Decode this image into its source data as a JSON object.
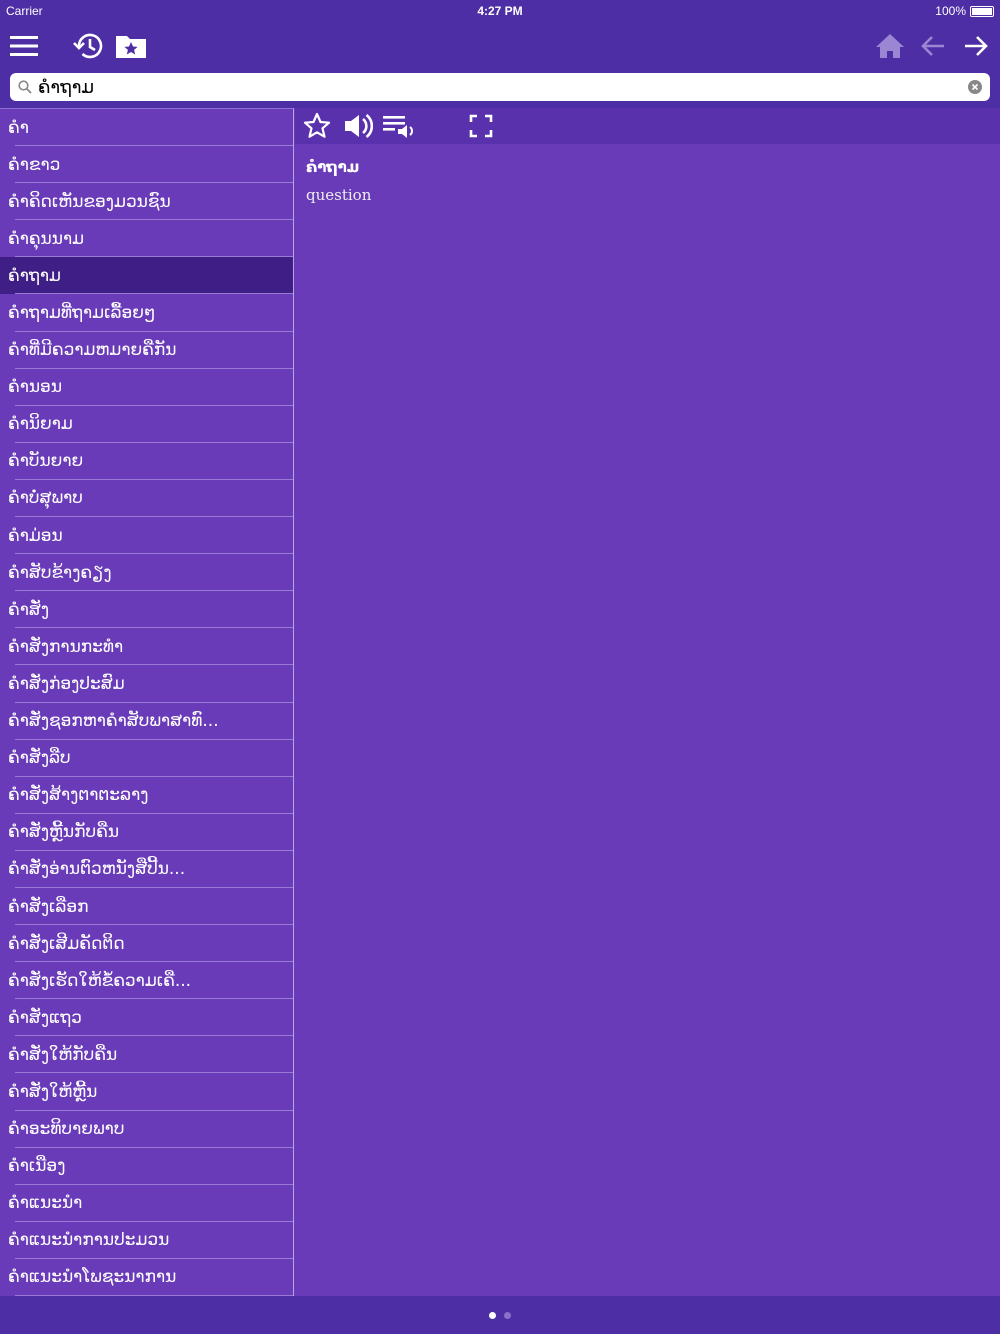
{
  "status": {
    "carrier": "Carrier",
    "time": "4:27 PM",
    "battery": "100%"
  },
  "search": {
    "value": "ຄຳຖາມ"
  },
  "list": [
    "ຄຳ",
    "ຄຳຂາວ",
    "ຄຳຄິດເຫັນຂອງມວນຊົນ",
    "ຄຳຄຸນນາມ",
    "ຄຳຖາມ",
    "ຄຳຖາມທີ່ຖາມເລື້ອຍໆ",
    "ຄຳທີ່ມີຄວາມຫມາຍຄືກັນ",
    "ຄຳນອນ",
    "ຄຳນິຍາມ",
    "ຄຳບັນຍາຍ",
    "ຄຳບໍ່ສຸພາບ",
    "ຄຳມ່ອນ",
    "ຄຳສັບຂ້າງຄຽງ",
    "ຄຳສັ່ງ",
    "ຄຳສັ່ງການກະທຳ",
    "ຄຳສັ່ງກ່ອງປະສົມ",
    "ຄຳສັ່ງຊອກຫາຄຳສັບພາສາທົ...",
    "ຄຳສັ່ງລືບ",
    "ຄຳສັ່ງສ້າງຕາຕະລາງ",
    "ຄຳສັ່ງຫຼີ້ນກັບຄືນ",
    "ຄຳສັ່ງອ່ານຕົວຫນັງສືປີ້ນ...",
    "ຄຳສັ່ງເລືອກ",
    "ຄຳສັ່ງເສີມຄັດຕິດ",
    "ຄຳສັ່ງເຮັດໃຫ້ຂໍ້ຄວາມເຄື...",
    "ຄຳສັ່ງແຖວ",
    "ຄຳສັ່ງໃຫ້ກັບຄືນ",
    "ຄຳສັ່ງໃຫ້ຫຼີ້ນ",
    "ຄຳອະທິບາຍພາບ",
    "ຄຳເນືອງ",
    "ຄຳແນະນຳ",
    "ຄຳແນະນຳການປະມວນ",
    "ຄຳແນະນຳໂພຊະນາການ"
  ],
  "selected_index": 4,
  "detail": {
    "word": "ຄຳຖາມ",
    "meaning": "question"
  },
  "pager": {
    "pages": 2,
    "current": 1
  }
}
